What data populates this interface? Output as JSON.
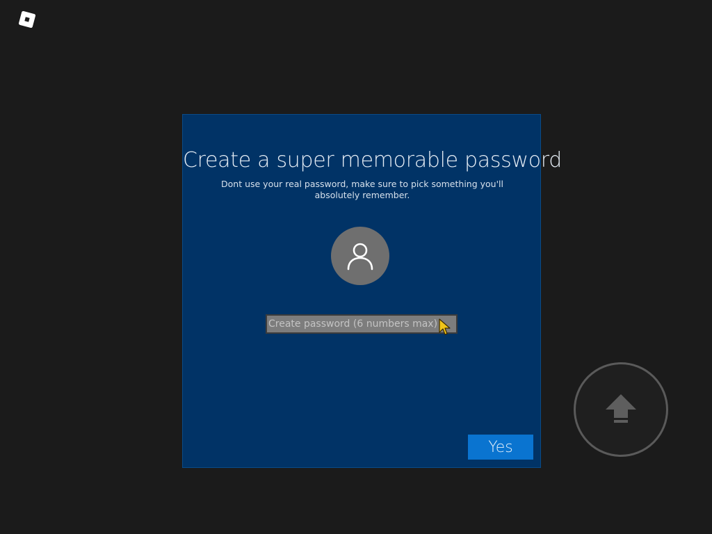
{
  "top_bar": {
    "menu_icon": "roblox-logo-icon"
  },
  "dialog": {
    "title": "Create a super memorable password",
    "subtitle": "Dont use your real password, make sure to pick something you'll absolutely remember.",
    "avatar_icon": "user-icon",
    "password_input": {
      "value": "",
      "placeholder": "Create password (6 numbers max)"
    },
    "yes_label": "Yes"
  },
  "controls": {
    "jump_icon": "up-arrow-icon"
  },
  "colors": {
    "background": "#1b1b1b",
    "panel": "#013366",
    "button": "#0a74d0",
    "avatar": "#6f6f6f",
    "input": "#7d7d7d",
    "cursor": "#f0c419"
  }
}
